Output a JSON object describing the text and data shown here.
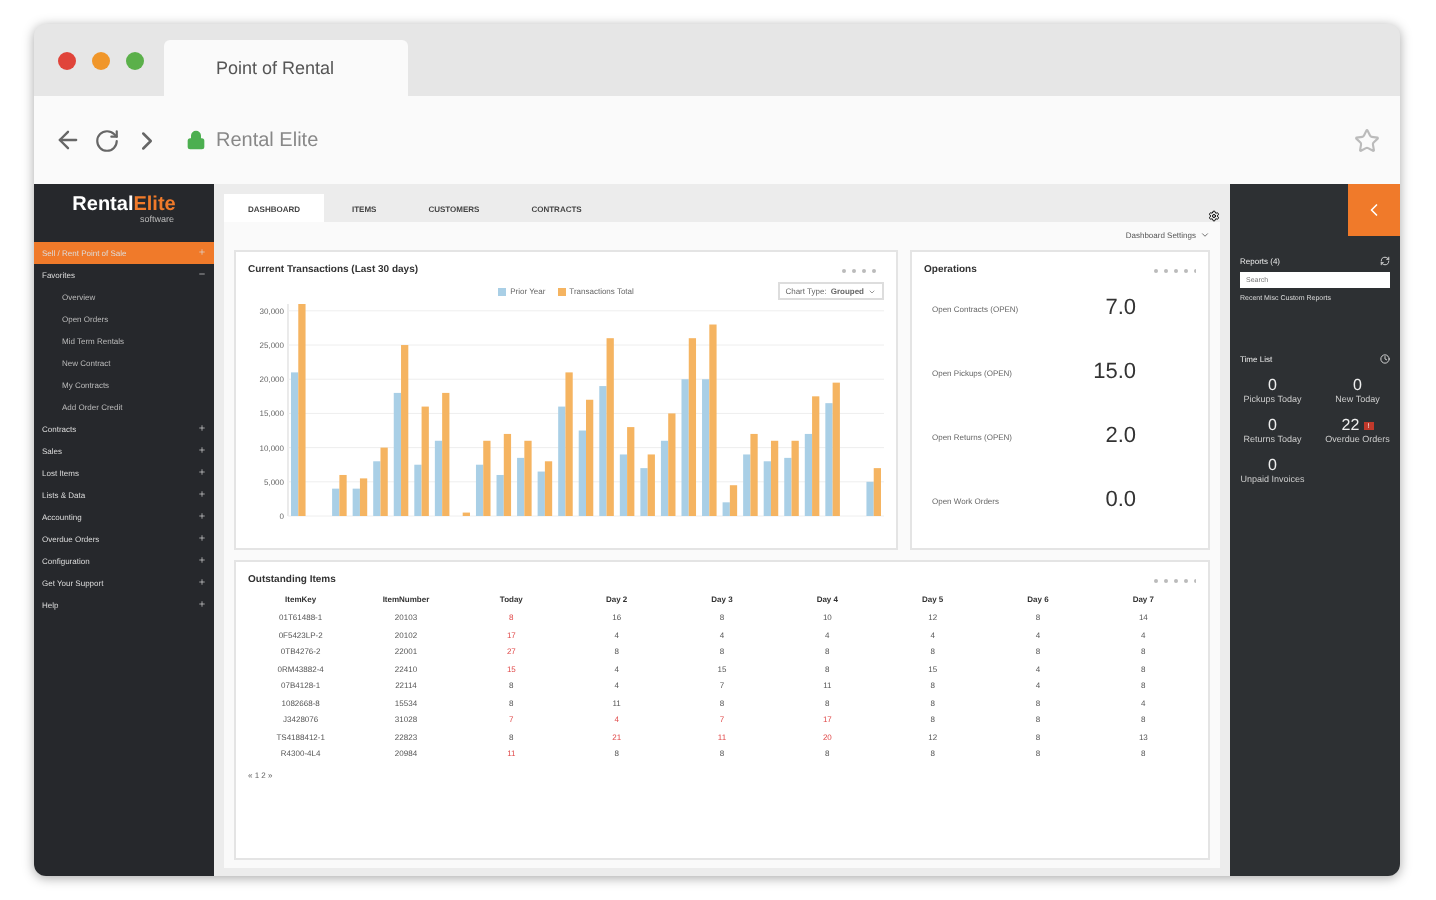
{
  "browser": {
    "tab_title": "Point of Rental",
    "address": "Rental Elite"
  },
  "sidebar": {
    "logo": {
      "main": "Rental",
      "accent": "Elite",
      "sub": "software"
    },
    "items": [
      {
        "label": "Sell / Rent Point of Sale",
        "selected": true,
        "expanded": false
      },
      {
        "label": "Favorites",
        "selected": false,
        "expanded": true,
        "children": [
          {
            "label": "Overview"
          },
          {
            "label": "Open Orders"
          },
          {
            "label": "Mid Term Rentals"
          },
          {
            "label": "New Contract"
          },
          {
            "label": "My Contracts"
          },
          {
            "label": "Add Order Credit"
          }
        ]
      },
      {
        "label": "Contracts",
        "selected": false,
        "expanded": false
      },
      {
        "label": "Sales",
        "selected": false,
        "expanded": false
      },
      {
        "label": "Lost Items",
        "selected": false,
        "expanded": false
      },
      {
        "label": "Lists & Data",
        "selected": false,
        "expanded": false
      },
      {
        "label": "Accounting",
        "selected": false,
        "expanded": false
      },
      {
        "label": "Overdue Orders",
        "selected": false,
        "expanded": false
      },
      {
        "label": "Configuration",
        "selected": false,
        "expanded": false
      },
      {
        "label": "Get Your Support",
        "selected": false,
        "expanded": false
      },
      {
        "label": "Help",
        "selected": false,
        "expanded": false
      }
    ]
  },
  "tabs": [
    {
      "label": "DASHBOARD",
      "selected": true
    },
    {
      "label": "ITEMS",
      "selected": false
    },
    {
      "label": "CUSTOMERS",
      "selected": false
    },
    {
      "label": "CONTRACTS",
      "selected": false
    }
  ],
  "dashboard_settings": "Dashboard Settings",
  "transactions": {
    "title": "Current Transactions (Last 30 days)",
    "chart_type_label": "Chart Type:",
    "chart_type": "Grouped",
    "chart_data": {
      "type": "bar",
      "grid": true,
      "ylim": [
        0,
        31000
      ],
      "yticks": [
        {
          "value": 0,
          "label": "0"
        },
        {
          "value": 5000,
          "label": "5,000"
        },
        {
          "value": 10000,
          "label": "10,000"
        },
        {
          "value": 15000,
          "label": "15,000"
        },
        {
          "value": 20000,
          "label": "20,000"
        },
        {
          "value": 25000,
          "label": "25,000"
        },
        {
          "value": 30000,
          "label": "30,000"
        }
      ],
      "series": [
        {
          "name": "Prior Year",
          "color": "#a9cfe6",
          "values": [
            21000,
            0,
            4000,
            4000,
            8000,
            18000,
            7500,
            11000,
            0,
            7500,
            6000,
            8500,
            6500,
            16000,
            12500,
            19000,
            9000,
            7000,
            11000,
            20000,
            20000,
            2000,
            9000,
            8000,
            8500,
            12000,
            16500,
            0,
            5000
          ]
        },
        {
          "name": "Transactions Total",
          "color": "#f5b461",
          "values": [
            31000,
            0,
            6000,
            5500,
            10000,
            25000,
            16000,
            18000,
            500,
            11000,
            12000,
            11000,
            8000,
            21000,
            17000,
            26000,
            13000,
            9000,
            15000,
            26000,
            28000,
            4500,
            12000,
            11000,
            11000,
            17500,
            19500,
            0,
            7000
          ]
        }
      ]
    }
  },
  "operations": {
    "title": "Operations",
    "metrics": [
      {
        "label": "Open Contracts (OPEN)",
        "value": "7.0"
      },
      {
        "label": "Open Pickups (OPEN)",
        "value": "15.0"
      },
      {
        "label": "Open Returns (OPEN)",
        "value": "2.0"
      },
      {
        "label": "Open Work Orders",
        "value": "0.0"
      }
    ]
  },
  "outstanding": {
    "title": "Outstanding Items",
    "columns": [
      "ItemKey",
      "ItemNumber",
      "Today",
      "Day 2",
      "Day 3",
      "Day 4",
      "Day 5",
      "Day 6",
      "Day 7"
    ],
    "rows": [
      {
        "cells": [
          {
            "text": "01T61488-1",
            "alert": false
          },
          {
            "text": "20103",
            "alert": false
          },
          {
            "text": "8",
            "alert": true
          },
          {
            "text": "16",
            "alert": false
          },
          {
            "text": "8",
            "alert": false
          },
          {
            "text": "10",
            "alert": false
          },
          {
            "text": "12",
            "alert": false
          },
          {
            "text": "8",
            "alert": false
          },
          {
            "text": "14",
            "alert": false
          }
        ]
      },
      {
        "cells": [
          {
            "text": "0F5423LP-2",
            "alert": false
          },
          {
            "text": "20102",
            "alert": false
          },
          {
            "text": "17",
            "alert": true
          },
          {
            "text": "4",
            "alert": false
          },
          {
            "text": "4",
            "alert": false
          },
          {
            "text": "4",
            "alert": false
          },
          {
            "text": "4",
            "alert": false
          },
          {
            "text": "4",
            "alert": false
          },
          {
            "text": "4",
            "alert": false
          }
        ]
      },
      {
        "cells": [
          {
            "text": "0TB4276-2",
            "alert": false
          },
          {
            "text": "22001",
            "alert": false
          },
          {
            "text": "27",
            "alert": true
          },
          {
            "text": "8",
            "alert": false
          },
          {
            "text": "8",
            "alert": false
          },
          {
            "text": "8",
            "alert": false
          },
          {
            "text": "8",
            "alert": false
          },
          {
            "text": "8",
            "alert": false
          },
          {
            "text": "8",
            "alert": false
          }
        ]
      },
      {
        "cells": [
          {
            "text": "0RM43882-4",
            "alert": false
          },
          {
            "text": "22410",
            "alert": false
          },
          {
            "text": "15",
            "alert": true
          },
          {
            "text": "4",
            "alert": false
          },
          {
            "text": "15",
            "alert": false
          },
          {
            "text": "8",
            "alert": false
          },
          {
            "text": "15",
            "alert": false
          },
          {
            "text": "4",
            "alert": false
          },
          {
            "text": "8",
            "alert": false
          }
        ]
      },
      {
        "cells": [
          {
            "text": "07B4128-1",
            "alert": false
          },
          {
            "text": "22114",
            "alert": false
          },
          {
            "text": "8",
            "alert": false
          },
          {
            "text": "4",
            "alert": false
          },
          {
            "text": "7",
            "alert": false
          },
          {
            "text": "11",
            "alert": false
          },
          {
            "text": "8",
            "alert": false
          },
          {
            "text": "4",
            "alert": false
          },
          {
            "text": "8",
            "alert": false
          }
        ]
      },
      {
        "cells": [
          {
            "text": "1082668-8",
            "alert": false
          },
          {
            "text": "15534",
            "alert": false
          },
          {
            "text": "8",
            "alert": false
          },
          {
            "text": "11",
            "alert": false
          },
          {
            "text": "8",
            "alert": false
          },
          {
            "text": "8",
            "alert": false
          },
          {
            "text": "8",
            "alert": false
          },
          {
            "text": "8",
            "alert": false
          },
          {
            "text": "4",
            "alert": false
          }
        ]
      },
      {
        "cells": [
          {
            "text": "J3428076",
            "alert": false
          },
          {
            "text": "31028",
            "alert": false
          },
          {
            "text": "7",
            "alert": true
          },
          {
            "text": "4",
            "alert": true
          },
          {
            "text": "7",
            "alert": true
          },
          {
            "text": "17",
            "alert": true
          },
          {
            "text": "8",
            "alert": false
          },
          {
            "text": "8",
            "alert": false
          },
          {
            "text": "8",
            "alert": false
          }
        ]
      },
      {
        "cells": [
          {
            "text": "TS4188412-1",
            "alert": false
          },
          {
            "text": "22823",
            "alert": false
          },
          {
            "text": "8",
            "alert": false
          },
          {
            "text": "21",
            "alert": true
          },
          {
            "text": "11",
            "alert": true
          },
          {
            "text": "20",
            "alert": true
          },
          {
            "text": "12",
            "alert": false
          },
          {
            "text": "8",
            "alert": false
          },
          {
            "text": "13",
            "alert": false
          }
        ]
      },
      {
        "cells": [
          {
            "text": "R4300-4L4",
            "alert": false
          },
          {
            "text": "20984",
            "alert": false
          },
          {
            "text": "11",
            "alert": true
          },
          {
            "text": "8",
            "alert": false
          },
          {
            "text": "8",
            "alert": false
          },
          {
            "text": "8",
            "alert": false
          },
          {
            "text": "8",
            "alert": false
          },
          {
            "text": "8",
            "alert": false
          },
          {
            "text": "8",
            "alert": false
          }
        ]
      }
    ],
    "pager": "« 1 2 »"
  },
  "reports": {
    "title": "Reports (4)",
    "placeholder": "Search",
    "link": "Recent Misc Custom Reports"
  },
  "time_list": {
    "title": "Time List",
    "stats": [
      {
        "value": "0",
        "label": "Pickups Today"
      },
      {
        "value": "0",
        "label": "New Today"
      },
      {
        "value": "0",
        "label": "Returns Today"
      },
      {
        "value": "22",
        "label": "Overdue Orders",
        "badge": "!"
      },
      {
        "value": "0",
        "label": "Unpaid Invoices"
      }
    ]
  }
}
